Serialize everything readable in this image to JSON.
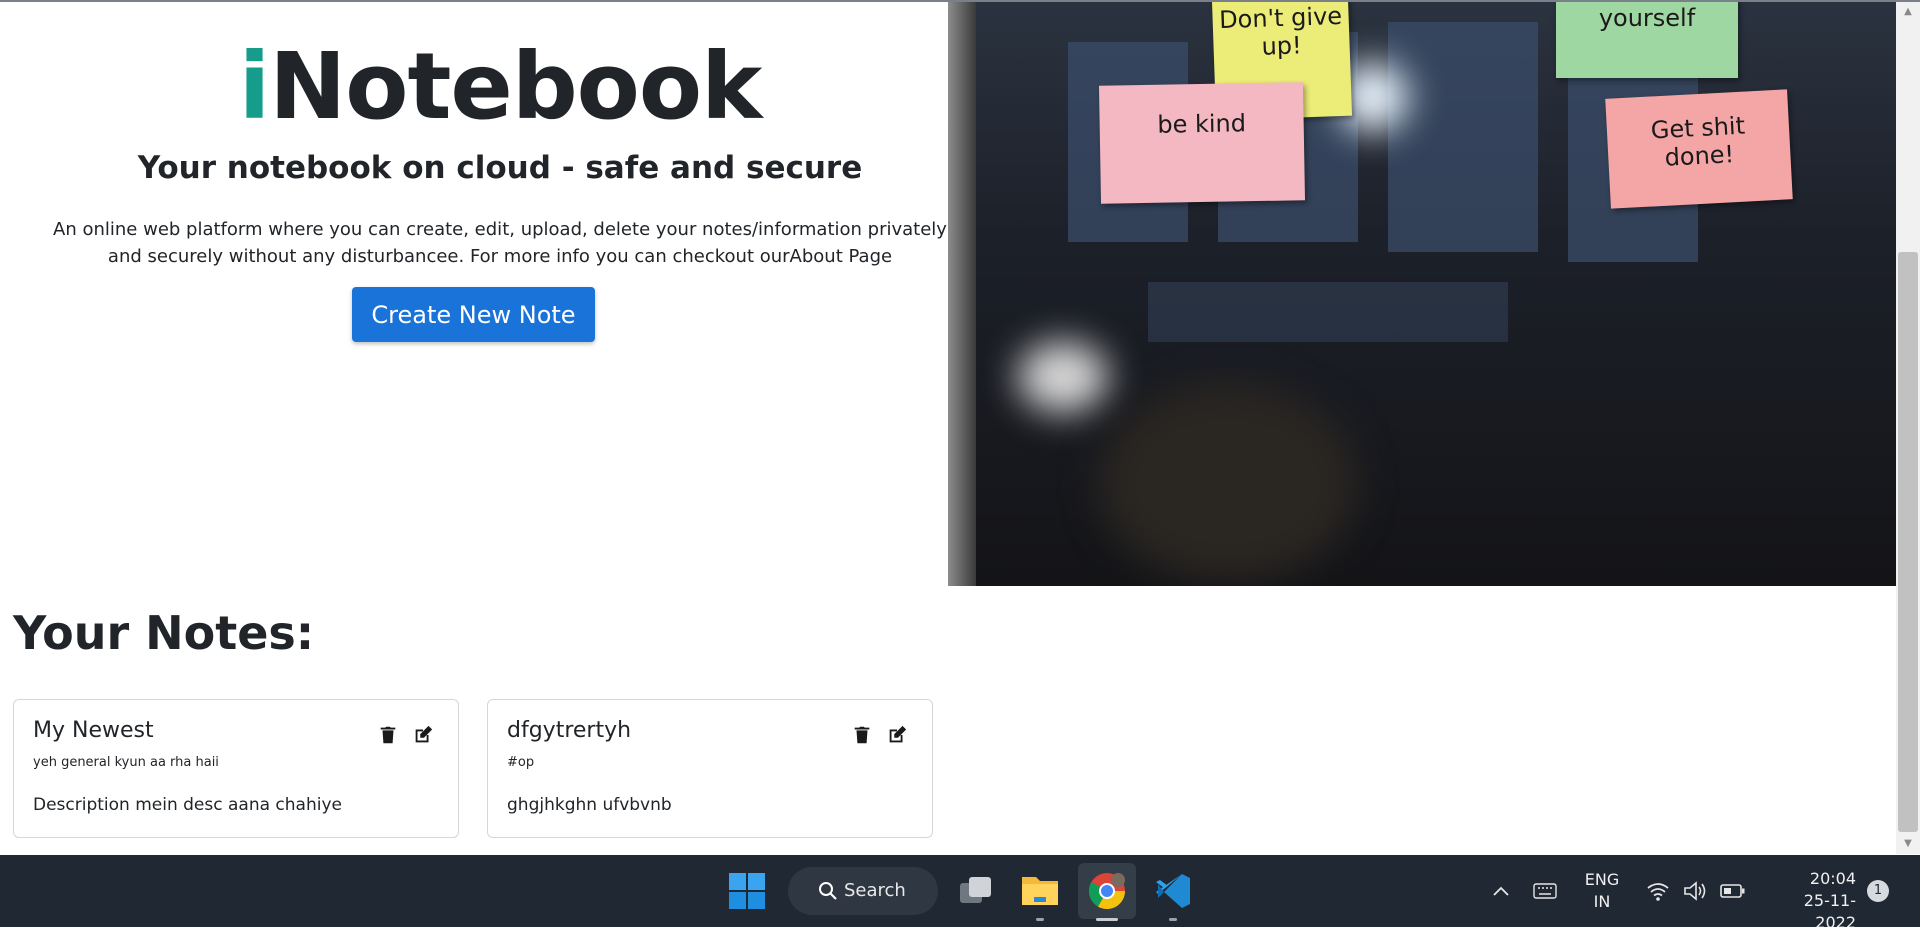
{
  "hero": {
    "brand_prefix": "i",
    "brand_rest": "Notebook",
    "tagline": "Your notebook on cloud - safe and secure",
    "description": "An online web platform where you can create, edit, upload, delete your notes/information privately and securely without any disturbancee. For more info you can checkout ourAbout Page",
    "create_button": "Create New Note",
    "image_notes": [
      {
        "text": "Don't give up!"
      },
      {
        "text": "be kind"
      },
      {
        "text": "yourself"
      },
      {
        "text": "Get shit done!"
      }
    ]
  },
  "notes_section": {
    "title": "Your Notes:",
    "notes": [
      {
        "title": "My Newest",
        "tag": "yeh general kyun aa rha haii",
        "description": "Description mein desc aana chahiye"
      },
      {
        "title": "dfgytrertyh",
        "tag": "#op",
        "description": "ghgjhkghn ufvbvnb"
      }
    ]
  },
  "taskbar": {
    "search_label": "Search",
    "language_line1": "ENG",
    "language_line2": "IN",
    "time": "20:04",
    "date": "25-11-2022",
    "notification_count": "1"
  },
  "colors": {
    "brand_accent": "#159c8a",
    "primary_button": "#1a73d9",
    "taskbar_bg": "#202933"
  },
  "icons": [
    "trash-icon",
    "edit-icon",
    "windows-start-icon",
    "search-icon",
    "task-view-icon",
    "file-explorer-icon",
    "chrome-icon",
    "vscode-icon",
    "chevron-up-icon",
    "keyboard-icon",
    "wifi-icon",
    "volume-icon",
    "battery-icon"
  ]
}
